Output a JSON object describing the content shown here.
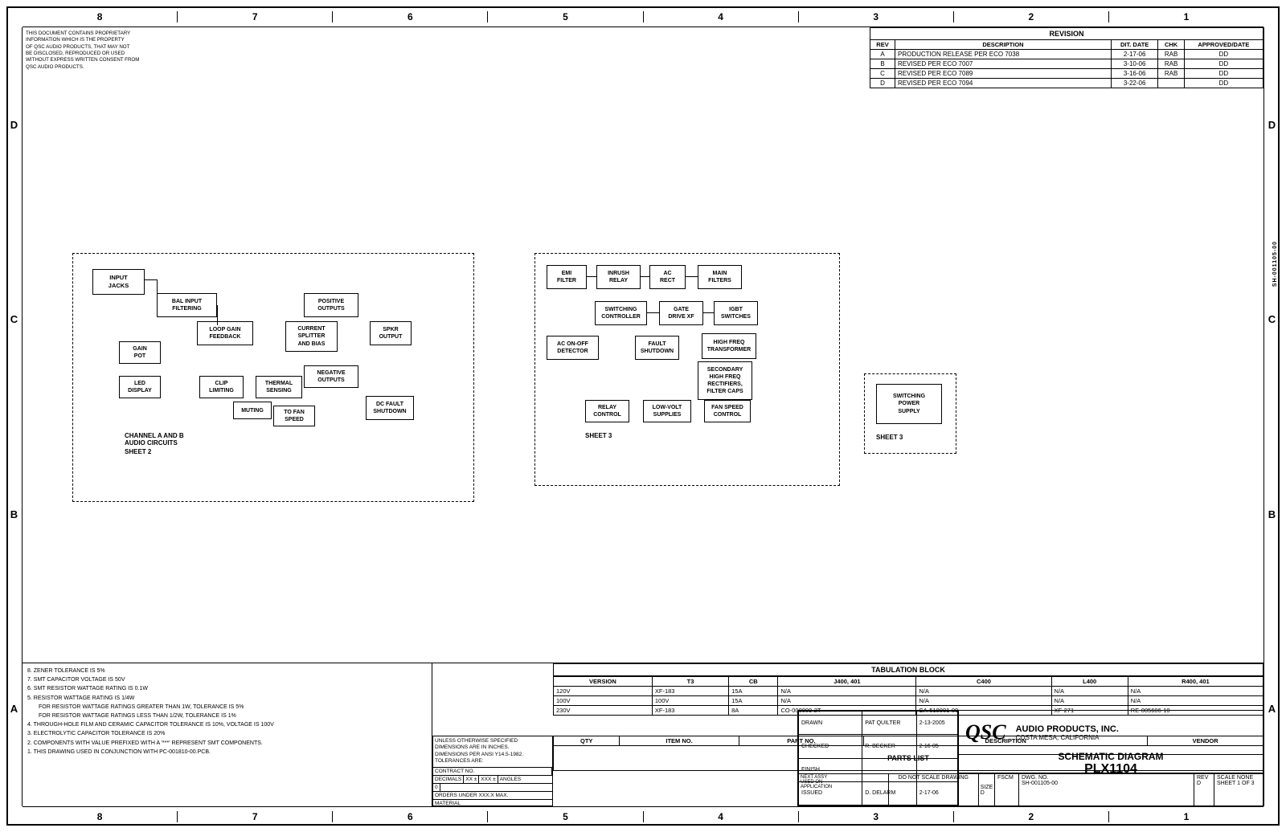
{
  "page": {
    "title": "SCHEMATIC DIAGRAM PLX1104",
    "company": "AUDIO PRODUCTS, INC.",
    "location": "COSTA MESA, CALIFORNIA",
    "logo": "QSC",
    "doc_no": "SH-001105-00",
    "sheet": "1 OF 3",
    "rev": "D"
  },
  "top_numbers": [
    "8",
    "7",
    "6",
    "5",
    "4",
    "3",
    "2",
    "1"
  ],
  "bottom_numbers": [
    "8",
    "7",
    "6",
    "5",
    "4",
    "3",
    "2",
    "1"
  ],
  "row_letters": [
    "D",
    "C",
    "B",
    "A"
  ],
  "proprietary": "THIS DOCUMENT CONTAINS PROPRIETARY\nINFORMATION WHICH IS THE PROPERTY\nOF QSC AUDIO PRODUCTS, THAT MAY NOT\nBE DISCLOSED, REPRODUCED OR USED\nWITHOUT EXPRESS WRITTEN CONSENT FROM\nQSC AUDIO PRODUCTS.",
  "revision_table": {
    "header": "REVISION",
    "cols": [
      "REV",
      "DESCRIPTION",
      "DIT. DATE",
      "CHK",
      "APPROVED/DATE"
    ],
    "rows": [
      [
        "A",
        "PRODUCTION RELEASE PER ECO 7038",
        "2-17-06",
        "RAB",
        "DD"
      ],
      [
        "B",
        "REVISED PER ECO 7007",
        "3-10-06",
        "RAB",
        "DD"
      ],
      [
        "C",
        "REVISED PER ECO 7089",
        "3-16-06",
        "RAB",
        "DD"
      ],
      [
        "D",
        "REVISED PER ECO 7094",
        "3-22-06",
        "",
        "DD"
      ]
    ]
  },
  "blocks": {
    "sheet1_left": {
      "input_jacks": "INPUT\nJACKS",
      "bal_input": "BAL INPUT\nFILTERING",
      "loop_gain": "LOOP GAIN\nFEEDBACK",
      "gain_pot": "GAIN\nPOT",
      "led_display": "LED\nDISPLAY",
      "clip_limiting": "CLIP\nLIMITING",
      "thermal_sensing": "THERMAL\nSENSING",
      "muting": "MUTING",
      "to_fan_speed": "TO FAN\nSPEED",
      "positive_outputs": "POSITIVE\nOUTPUTS",
      "current_splitter": "CURRENT\nSPLITTER\nAND BIAS",
      "spkr_output": "SPKR\nOUTPUT",
      "negative_outputs": "NEGATIVE\nOUTPUTS",
      "dc_fault_shutdown": "DC FAULT\nSHUTDOWN",
      "channel_a_b": "CHANNEL A AND B\nAUDIO CIRCUITS",
      "sheet2": "SHEET 2"
    },
    "sheet2_center": {
      "emi_filter": "EMI\nFILTER",
      "inrush_relay": "INRUSH\nRELAY",
      "ac_rect": "AC\nRECT",
      "main_filters": "MAIN\nFILTERS",
      "switching_controller": "SWITCHING\nCONTROLLER",
      "gate_drive_xf": "GATE\nDRIVE XF",
      "igbt_switches": "IGBT\nSWITCHES",
      "ac_on_off_detector": "AC ON-OFF\nDETECTOR",
      "fault_shutdown": "FAULT\nSHUTDOWN",
      "high_freq_transformer": "HIGH FREQ\nTRANSFORMER",
      "secondary_high_freq": "SECONDARY\nHIGH FREQ\nRECTIFIERS,\nFILTER CAPS",
      "relay_control": "RELAY\nCONTROL",
      "low_volt_supplies": "LOW-VOLT\nSUPPLIES",
      "fan_speed_control": "FAN SPEED\nCONTROL",
      "sheet3": "SHEET 3"
    },
    "sheet3_right": {
      "switching_power_supply": "SWITCHING\nPOWER\nSUPPLY",
      "sheet3_label": "SHEET 3"
    }
  },
  "tabulation": {
    "title": "TABULATION BLOCK",
    "headers": [
      "VERSION",
      "T3",
      "CB",
      "J400, 401",
      "C400",
      "L400",
      "R400, 401"
    ],
    "rows": [
      [
        "120V",
        "XF-183",
        "15A",
        "N/A",
        "N/A",
        "N/A",
        "N/A"
      ],
      [
        "100V",
        "100V",
        "15A",
        "N/A",
        "N/A",
        "N/A",
        "N/A"
      ],
      [
        "230V",
        "XF-183",
        "8A",
        "CO-000009-2T",
        "CA-518001-00",
        "XF-271",
        "RE-005606-10"
      ]
    ]
  },
  "parts_list": {
    "title": "PARTS LIST",
    "headers": [
      "QTY",
      "ITEM NO.",
      "PART NO.",
      "DESCRIPTION",
      "VENDOR"
    ]
  },
  "drawing_info": {
    "unless_noted": "UNLESS OTHERWISE SPECIFIED\nDIMENSIONS ARE IN INCHES.\nDIMENSIONS PER ANSI Y14.5-1982.\nTOLERANCES ARE:",
    "decimals_label": "DECIMALS",
    "decimals_xx": "XX ±",
    "decimals_xxx": "XXX ±",
    "decimals_angles": "ANGLES",
    "dimension_0": "0",
    "tolerances_order": "ORDERS UNDER XXX.X MAX.",
    "material": "MATERIAL",
    "contract_no": "CONTRACT NO.",
    "approvals": [
      {
        "role": "DRAWN",
        "name": "PAT QUILTER",
        "date": "2-13-2005"
      },
      {
        "role": "CHECKED",
        "name": "R. BECKER",
        "date": "2-16-05"
      },
      {
        "role": "FINISH",
        "name": "",
        "date": ""
      },
      {
        "role": "ISSUED",
        "name": "D. DELARM",
        "date": "2-17-06"
      }
    ],
    "size": "D",
    "fscm": "",
    "dwg_no": "SH-001105-00",
    "rev": "D",
    "scale": "NONE",
    "sheet": "1 OF 3",
    "cad_seed": "",
    "next_assy": "",
    "used_on": "",
    "application": ""
  },
  "notes": [
    "8. ZENER TOLERANCE IS 5%",
    "7. SMT CAPACITOR VOLTAGE IS 50V",
    "6. SMT RESISTOR WATTAGE RATING IS 0.1W",
    "5. RESISTOR WATTAGE RATING IS 1/4W",
    "   FOR RESISTOR WATTAGE RATINGS GREATER THAN 1W, TOLERANCE IS 5%",
    "   FOR RESISTOR WATTAGE RATINGS LESS THAN 1/2W, TOLERANCE IS 1%",
    "4. THROUGH-HOLE FILM AND CERAMIC CAPACITOR TOLERANCE IS 10%, VOLTAGE IS 100V",
    "3. ELECTROLYTIC CAPACITOR TOLERANCE IS 20%",
    "2. COMPONENTS WITH VALUE PREFIXED WITH A '***' REPRESENT SMT COMPONENTS.",
    "1. THIS DRAWING USED IN CONJUNCTION WITH PC-001810-00.PCB."
  ],
  "colors": {
    "border": "#000000",
    "background": "#ffffff",
    "text": "#000000"
  }
}
